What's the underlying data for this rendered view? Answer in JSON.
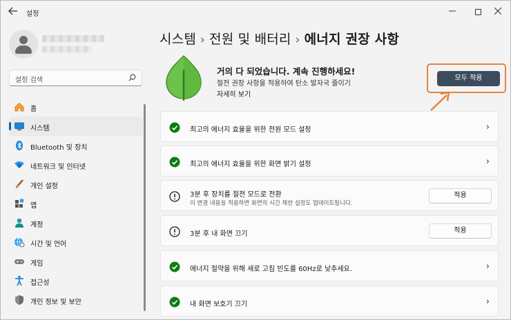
{
  "window": {
    "title": "설정"
  },
  "sidebar": {
    "search_placeholder": "설정 검색",
    "items": [
      {
        "label": "홈",
        "icon": "home-icon"
      },
      {
        "label": "시스템",
        "icon": "system-icon",
        "active": true
      },
      {
        "label": "Bluetooth 및 장치",
        "icon": "bluetooth-icon"
      },
      {
        "label": "네트워크 및 인터넷",
        "icon": "network-icon"
      },
      {
        "label": "개인 설정",
        "icon": "brush-icon"
      },
      {
        "label": "앱",
        "icon": "apps-icon"
      },
      {
        "label": "계정",
        "icon": "account-icon"
      },
      {
        "label": "시간 및 언어",
        "icon": "globe-clock-icon"
      },
      {
        "label": "게임",
        "icon": "gamepad-icon"
      },
      {
        "label": "접근성",
        "icon": "accessibility-icon"
      },
      {
        "label": "개인 정보 및 보안",
        "icon": "shield-icon"
      }
    ]
  },
  "breadcrumb": {
    "level1": "시스템",
    "level2": "전원 및 배터리",
    "current": "에너지 권장 사항"
  },
  "hero": {
    "title": "거의 다 되었습니다. 계속 진행하세요!",
    "subtitle": "절전 권장 사항을 적용하여 탄소 발자국 줄이기",
    "link": "자세히 보기",
    "apply_all_label": "모두 적용"
  },
  "recommendations": [
    {
      "title": "최고의 에너지 효율을 위한 전원 모드 설정",
      "status": "done"
    },
    {
      "title": "최고의 에너지 효율을 위한 화면 밝기 설정",
      "status": "done"
    },
    {
      "title": "3분 후 장치를 절전 모드로 전환",
      "desc": "이 변경 내용을 적용하면 화면의 시간 제한 설정도 업데이트됩니다.",
      "status": "pending",
      "button": "적용"
    },
    {
      "title": "3분 후 내 화면 끄기",
      "status": "pending",
      "button": "적용"
    },
    {
      "title": "에너지 절약을 위해 새로 고침 빈도를 60Hz로 낮추세요.",
      "status": "done"
    },
    {
      "title": "내 화면 보호기 끄기",
      "status": "done"
    }
  ],
  "colors": {
    "accent": "#0067c0",
    "success": "#0f7b0f",
    "highlight": "#e8833a",
    "primary_button": "#3c4c5c"
  }
}
